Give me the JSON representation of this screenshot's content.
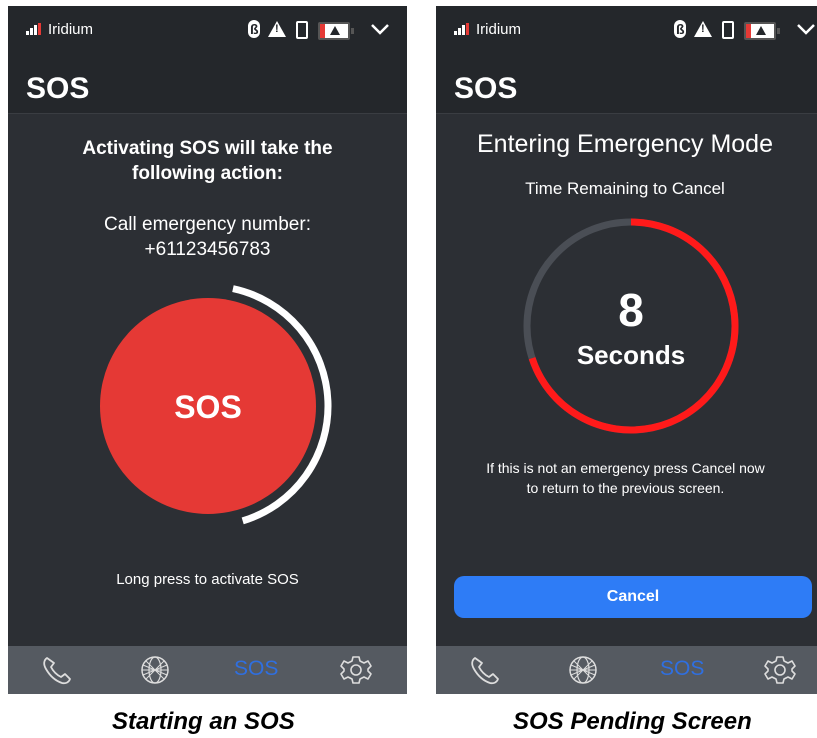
{
  "status_bar": {
    "carrier": "Iridium"
  },
  "screen1": {
    "title": "SOS",
    "heading_line1": "Activating SOS will take the",
    "heading_line2": "following action:",
    "action_line1": "Call emergency number:",
    "action_line2": "+61123456783",
    "sos_button": "SOS",
    "hint": "Long press to activate SOS",
    "press_progress": 0.42
  },
  "screen2": {
    "title": "SOS",
    "heading": "Entering Emergency Mode",
    "subheading": "Time Remaining to Cancel",
    "countdown_value": "8",
    "countdown_unit": "Seconds",
    "countdown_progress": 0.7,
    "note_line1": "If this is not an emergency press Cancel now",
    "note_line2": "to return to the previous screen.",
    "cancel_label": "Cancel"
  },
  "nav": {
    "items": [
      {
        "icon": "phone-icon"
      },
      {
        "icon": "globe-icon"
      },
      {
        "label": "SOS"
      },
      {
        "icon": "gear-icon"
      }
    ]
  },
  "captions": {
    "left": "Starting an SOS",
    "right": "SOS Pending Screen"
  },
  "colors": {
    "background": "#2c2f34",
    "sos_red": "#e53935",
    "accent_blue": "#2e7cf6",
    "navbar": "#555a61"
  }
}
